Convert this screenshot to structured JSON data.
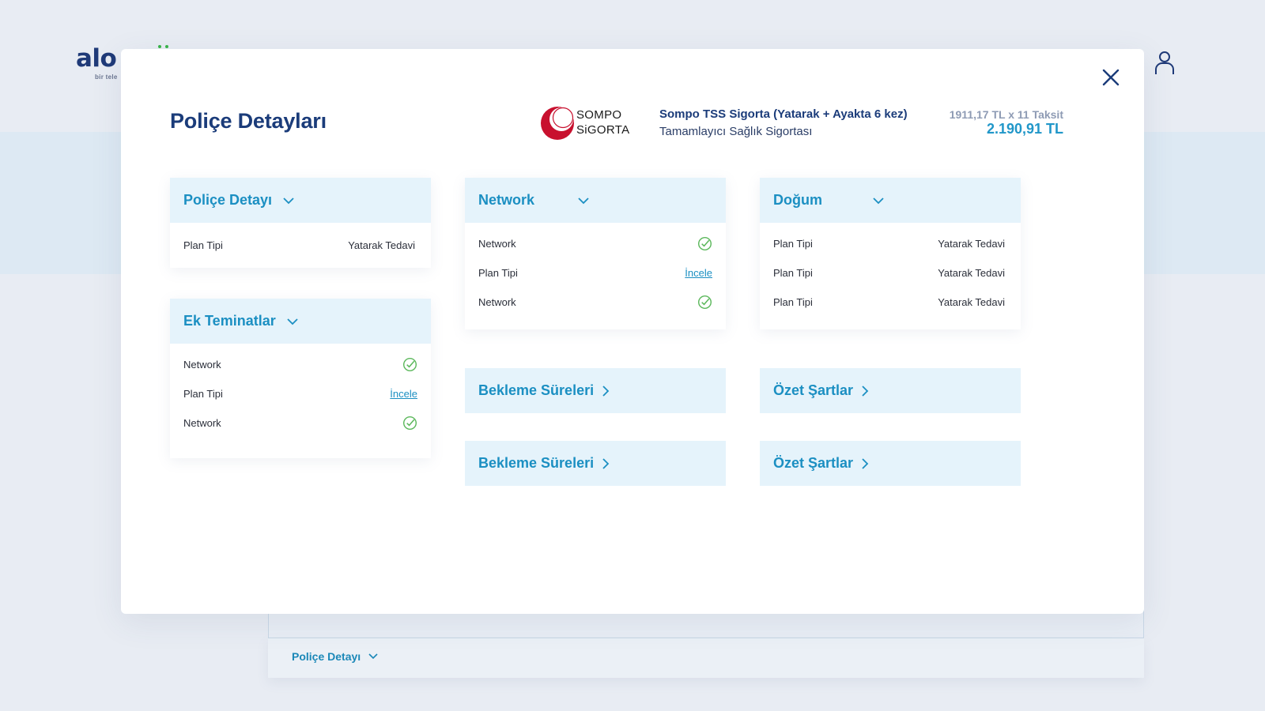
{
  "background": {
    "logo": "alo",
    "logo_sub": "bir tele",
    "bottom_tab": "Poliçe Detayı"
  },
  "modal": {
    "title": "Poliçe Detayları",
    "brand": {
      "line1": "SOMPO",
      "line2": "SiGORTA",
      "color": "#c8102e"
    },
    "policy_name": "Sompo TSS Sigorta (Yatarak + Ayakta 6 kez)",
    "policy_type": "Tamamlayıcı Sağlık Sigortası",
    "price_installment": "1911,17 TL x 11 Taksit",
    "price_total": "2.190,91 TL"
  },
  "panels": {
    "police_detayi": {
      "title": "Poliçe Detayı",
      "rows": [
        {
          "label": "Plan Tipi",
          "value": "Yatarak Tedavi"
        }
      ]
    },
    "ek_teminatlar": {
      "title": "Ek Teminatlar",
      "rows": [
        {
          "label": "Network"
        },
        {
          "label": "Plan Tipi",
          "link": "İncele"
        },
        {
          "label": "Network"
        }
      ]
    },
    "network": {
      "title": "Network",
      "rows": [
        {
          "label": "Network"
        },
        {
          "label": "Plan Tipi",
          "link": "İncele"
        },
        {
          "label": "Network"
        }
      ]
    },
    "dogum": {
      "title": "Doğum",
      "rows": [
        {
          "label": "Plan Tipi",
          "value": "Yatarak Tedavi"
        },
        {
          "label": "Plan Tipi",
          "value": "Yatarak Tedavi"
        },
        {
          "label": "Plan Tipi",
          "value": "Yatarak Tedavi"
        }
      ]
    }
  },
  "links": {
    "bekleme_1": "Bekleme Süreleri",
    "bekleme_2": "Bekleme Süreleri",
    "ozet_1": "Özet Şartlar",
    "ozet_2": "Özet Şartlar"
  },
  "colors": {
    "accent": "#1b8fc2",
    "navy": "#1b3c7a",
    "panel_header": "#e5f3fb",
    "check_green": "#5cb85c"
  }
}
